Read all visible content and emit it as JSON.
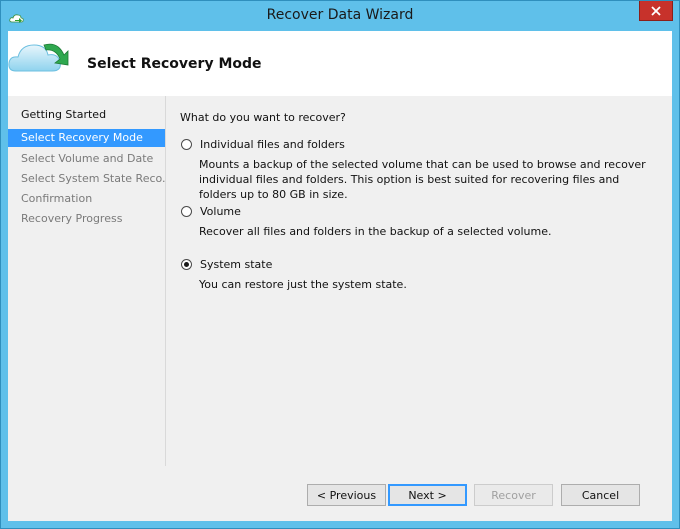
{
  "window": {
    "title": "Recover Data Wizard"
  },
  "header": {
    "title": "Select Recovery Mode"
  },
  "nav": {
    "items": [
      {
        "label": "Getting Started",
        "state": "done"
      },
      {
        "label": "Select Recovery Mode",
        "state": "active"
      },
      {
        "label": "Select Volume and Date",
        "state": "pending"
      },
      {
        "label": "Select System State Reco...",
        "state": "pending"
      },
      {
        "label": "Confirmation",
        "state": "pending"
      },
      {
        "label": "Recovery Progress",
        "state": "pending"
      }
    ]
  },
  "main": {
    "question": "What do you want to recover?",
    "options": [
      {
        "label": "Individual files and folders",
        "description": "Mounts a backup of the selected volume that can be used to browse and recover individual files and folders. This option is best suited for recovering files and folders up to 80 GB in size.",
        "checked": false
      },
      {
        "label": "Volume",
        "description": "Recover all files and folders in the backup of a selected volume.",
        "checked": false
      },
      {
        "label": "System state",
        "description": "You can restore just the system state.",
        "checked": true
      }
    ]
  },
  "buttons": {
    "previous": "< Previous",
    "next": "Next >",
    "recover": "Recover",
    "cancel": "Cancel"
  },
  "colors": {
    "accent": "#3399ff",
    "frame": "#5fc0ea",
    "close": "#c7322b"
  }
}
